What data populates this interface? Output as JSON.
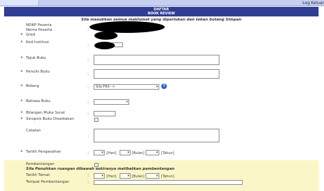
{
  "topbar": {
    "right_text": "Log Keluar"
  },
  "header": {
    "title": "DAFTAR",
    "subtitle": "BOOK REVIEW"
  },
  "notice": "Sila masukkan semua maklumat yang diperlukan dan tekan butang Simpan",
  "fields": {
    "nokp": {
      "label": "NOKP Peserta"
    },
    "nama": {
      "label": "Nama Peserta"
    },
    "gred": {
      "label": "Gred"
    },
    "kod": {
      "label": "Kod Institusi"
    },
    "tajuk": {
      "label": "Tajuk Buku"
    },
    "penulis": {
      "label": "Penulis Buku"
    },
    "bidang": {
      "label": "Bidang",
      "selected": "Sila Pilih ->"
    },
    "bahasa": {
      "label": "Bahasa Buku"
    },
    "muka": {
      "label": "Bilangan Muka Surat"
    },
    "sinopsis": {
      "label": "Sinopsis Buku Disediakan"
    },
    "catatan": {
      "label": "Catatan"
    },
    "pengesahan": {
      "label": "Tarikh Pengesahan"
    },
    "pembentangan": {
      "label": "Pembentangan"
    },
    "tamat": {
      "label": "Tarikh Tamat"
    },
    "tempat": {
      "label": "Tempat Pembentangan"
    }
  },
  "date_units": {
    "day": "[Hari]",
    "month": "[Bulan]",
    "year": "[Tahun]"
  },
  "instruction": "Sila Penuhkan ruangan dibawah sekiranya melibatkan pembentangan",
  "help_icon_glyph": "?",
  "colors": {
    "header_bg": "#2f3d92",
    "required": "#cc0000",
    "yellow_panel": "#fbf6c8",
    "help_icon": "#2a5fc7"
  }
}
